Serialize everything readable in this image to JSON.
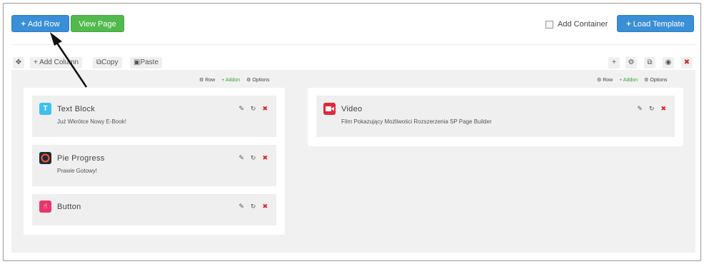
{
  "toolbar": {
    "add_row": "Add Row",
    "view_page": "View Page",
    "add_container": "Add Container",
    "load_template": "Load Template"
  },
  "row_toolbar": {
    "add_column": "Add Column",
    "copy": "Copy",
    "paste": "Paste"
  },
  "column_options": {
    "row": "Row",
    "addon": "Addon",
    "options": "Options"
  },
  "columns": [
    {
      "addons": [
        {
          "title": "Text Block",
          "subtitle": "Już Wkrótce Nowy E-Book!",
          "icon": "text-block-icon",
          "color": "#3fbfee",
          "glyph": "T"
        },
        {
          "title": "Pie Progress",
          "subtitle": "Prawie Gotowy!",
          "icon": "pie-progress-icon",
          "color": "#1f2b3a",
          "glyph": ""
        },
        {
          "title": "Button",
          "subtitle": "",
          "icon": "button-hand-icon",
          "color": "#e8366b",
          "glyph": ""
        }
      ]
    },
    {
      "addons": [
        {
          "title": "Video",
          "subtitle": "Film Pokazujący Możliwości Rozszerzenia SP Page Builder",
          "icon": "video-camera-icon",
          "color": "#e0283a",
          "glyph": ""
        }
      ]
    }
  ],
  "colors": {
    "primary": "#3a8fd6",
    "success": "#52b94d",
    "danger": "#e02222"
  }
}
